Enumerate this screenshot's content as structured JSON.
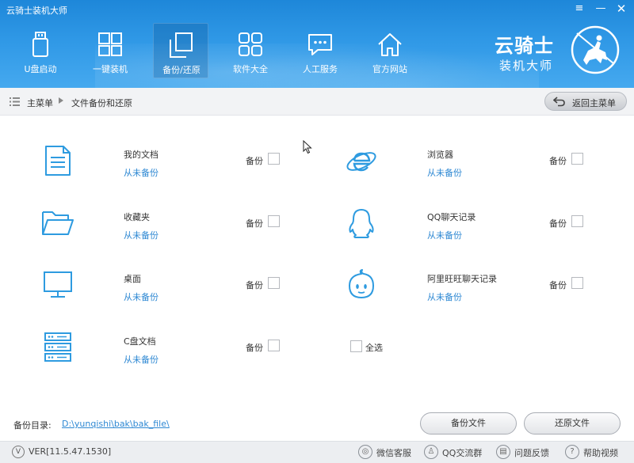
{
  "app": {
    "title": "云骑士装机大师"
  },
  "window_controls": {
    "menu": "≡",
    "minimize": "—",
    "close": "✕"
  },
  "nav": [
    {
      "label": "U盘启动",
      "icon": "usb-drive-icon"
    },
    {
      "label": "一键装机",
      "icon": "windows-icon"
    },
    {
      "label": "备份/还原",
      "icon": "backup-restore-icon",
      "active": true
    },
    {
      "label": "软件大全",
      "icon": "apps-grid-icon"
    },
    {
      "label": "人工服务",
      "icon": "chat-bubble-icon"
    },
    {
      "label": "官方网站",
      "icon": "home-icon"
    }
  ],
  "brand": {
    "main": "云骑士",
    "sub": "装机大师"
  },
  "breadcrumb": {
    "home": "主菜单",
    "current": "文件备份和还原",
    "back_button": "返回主菜单"
  },
  "items": [
    {
      "name": "我的文档",
      "status": "从未备份",
      "backup_label": "备份",
      "icon": "document-icon"
    },
    {
      "name": "浏览器",
      "status": "从未备份",
      "backup_label": "备份",
      "icon": "ie-browser-icon"
    },
    {
      "name": "收藏夹",
      "status": "从未备份",
      "backup_label": "备份",
      "icon": "folder-icon"
    },
    {
      "name": "QQ聊天记录",
      "status": "从未备份",
      "backup_label": "备份",
      "icon": "qq-penguin-icon"
    },
    {
      "name": "桌面",
      "status": "从未备份",
      "backup_label": "备份",
      "icon": "monitor-icon"
    },
    {
      "name": "阿里旺旺聊天记录",
      "status": "从未备份",
      "backup_label": "备份",
      "icon": "wangwang-icon"
    },
    {
      "name": "C盘文档",
      "status": "从未备份",
      "backup_label": "备份",
      "icon": "server-drive-icon"
    }
  ],
  "select_all": "全选",
  "backup_dir": {
    "label": "备份目录:",
    "path": "D:\\yunqishi\\bak\\bak_file\\"
  },
  "buttons": {
    "backup": "备份文件",
    "restore": "还原文件"
  },
  "footer": {
    "version": "VER[11.5.47.1530]",
    "links": [
      {
        "label": "微信客服",
        "icon": "wechat-icon"
      },
      {
        "label": "QQ交流群",
        "icon": "qq-icon"
      },
      {
        "label": "问题反馈",
        "icon": "feedback-icon"
      },
      {
        "label": "帮助视频",
        "icon": "help-icon"
      }
    ]
  },
  "colors": {
    "header_blue": "#2f98e6",
    "link_blue": "#2e88d3",
    "icon_blue": "#2e9be0"
  }
}
